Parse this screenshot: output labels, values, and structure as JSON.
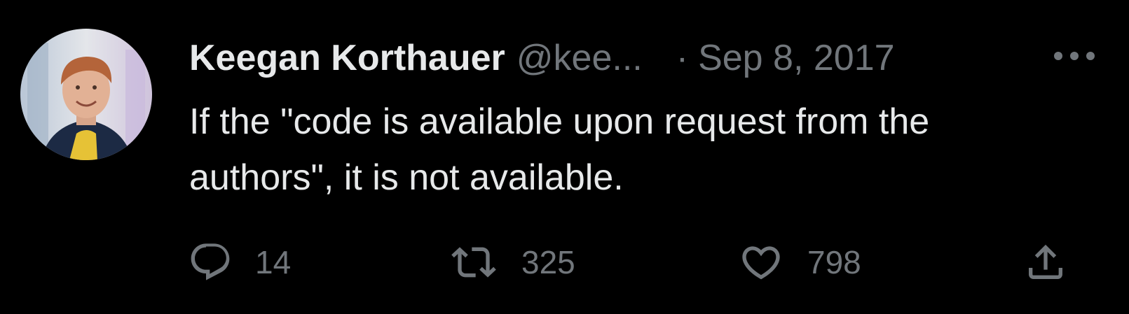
{
  "tweet": {
    "author": {
      "name": "Keegan Korthauer",
      "handle": "@kee..."
    },
    "separator": "·",
    "date": "Sep 8, 2017",
    "text": "If the \"code is available upon request from the\nauthors\", it is not available.",
    "actions": {
      "reply_count": "14",
      "retweet_count": "325",
      "like_count": "798"
    }
  },
  "icons": {
    "more": "more-icon",
    "reply": "reply-icon",
    "retweet": "retweet-icon",
    "like": "heart-icon",
    "share": "share-icon"
  },
  "colors": {
    "background": "#000000",
    "primary_text": "#e7e9ea",
    "secondary_text": "#71767b"
  }
}
